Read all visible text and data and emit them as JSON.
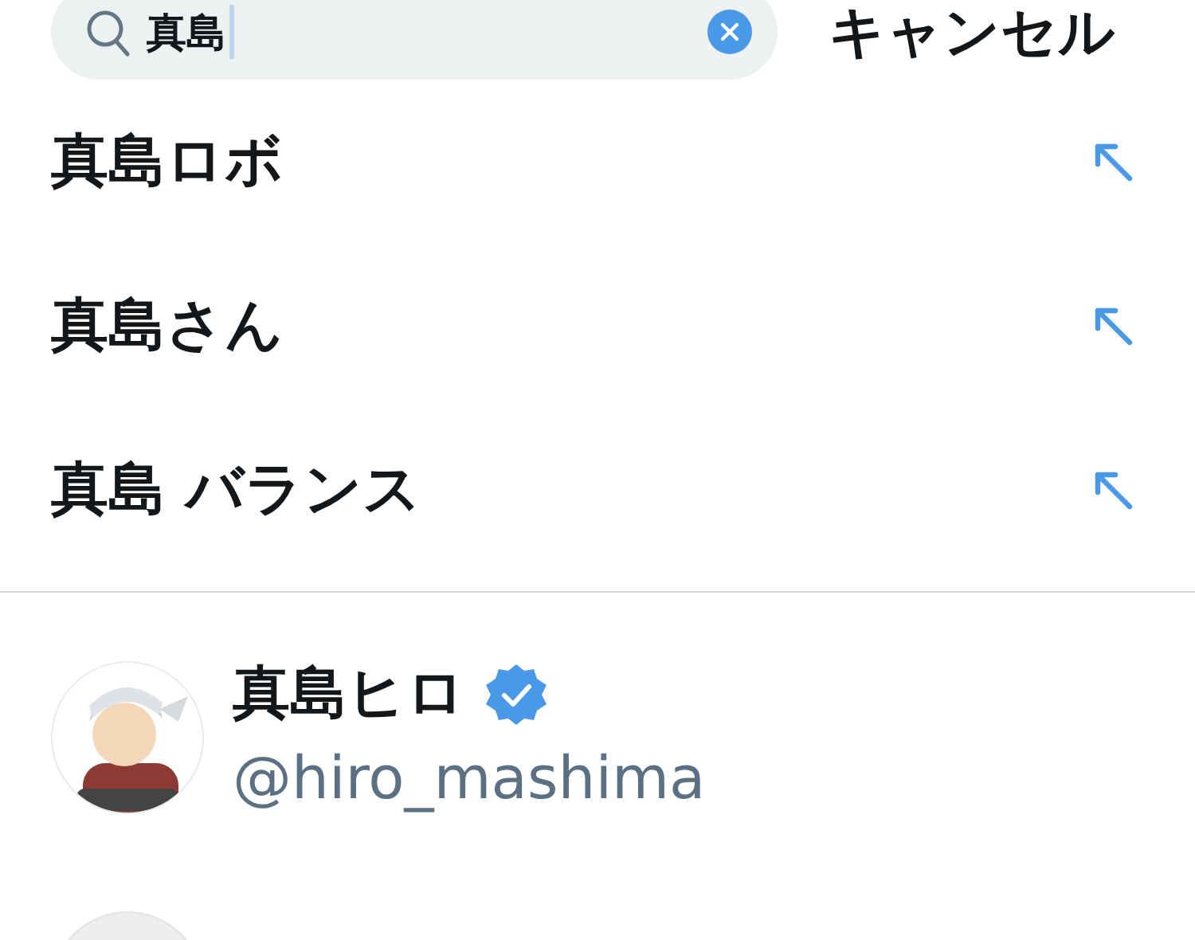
{
  "search": {
    "value": "真島",
    "focused": true,
    "cancel": "キャンセル"
  },
  "suggestions": [
    {
      "text": "真島ロボ"
    },
    {
      "text": "真島さん"
    },
    {
      "text": "真島 バランス"
    }
  ],
  "users": [
    {
      "name": "真島ヒロ",
      "handle": "@hiro_mashima",
      "verified": true
    }
  ]
}
